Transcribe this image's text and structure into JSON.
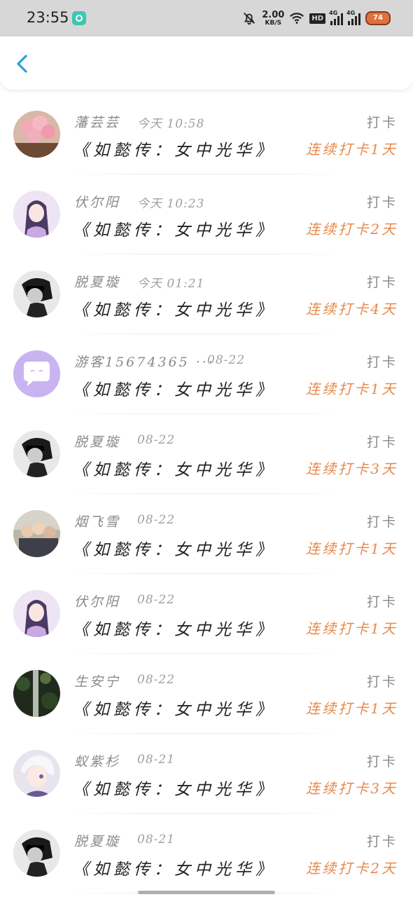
{
  "status_bar": {
    "time": "23:55",
    "speed_value": "2.00",
    "speed_unit": "KB/S",
    "hd_label": "HD",
    "net1": "4G",
    "net2": "4G",
    "battery": "74"
  },
  "header": {
    "back_icon": "chevron-left-icon"
  },
  "entries": [
    {
      "name": "藩芸芸",
      "time": "今天 10:58",
      "action": "打卡",
      "book": "《如懿传：女中光华》",
      "streak": "连续打卡1天",
      "avatar": "pink"
    },
    {
      "name": "伏尔阳",
      "time": "今天 10:23",
      "action": "打卡",
      "book": "《如懿传：女中光华》",
      "streak": "连续打卡2天",
      "avatar": "anime-purple"
    },
    {
      "name": "脱夏璇",
      "time": "今天 01:21",
      "action": "打卡",
      "book": "《如懿传：女中光华》",
      "streak": "连续打卡4天",
      "avatar": "bw"
    },
    {
      "name": "游客15674365 ···",
      "time": "08-22",
      "action": "打卡",
      "book": "《如懿传：女中光华》",
      "streak": "连续打卡1天",
      "avatar": "guest"
    },
    {
      "name": "脱夏璇",
      "time": "08-22",
      "action": "打卡",
      "book": "《如懿传：女中光华》",
      "streak": "连续打卡3天",
      "avatar": "bw"
    },
    {
      "name": "烟飞雪",
      "time": "08-22",
      "action": "打卡",
      "book": "《如懿传：女中光华》",
      "streak": "连续打卡1天",
      "avatar": "group"
    },
    {
      "name": "伏尔阳",
      "time": "08-22",
      "action": "打卡",
      "book": "《如懿传：女中光华》",
      "streak": "连续打卡1天",
      "avatar": "anime-purple"
    },
    {
      "name": "生安宁",
      "time": "08-22",
      "action": "打卡",
      "book": "《如懿传：女中光华》",
      "streak": "连续打卡1天",
      "avatar": "forest"
    },
    {
      "name": "蚁紫杉",
      "time": "08-21",
      "action": "打卡",
      "book": "《如懿传：女中光华》",
      "streak": "连续打卡3天",
      "avatar": "anime-white"
    },
    {
      "name": "脱夏璇",
      "time": "08-21",
      "action": "打卡",
      "book": "《如懿传：女中光华》",
      "streak": "连续打卡2天",
      "avatar": "bw"
    }
  ],
  "colors": {
    "accent_orange": "#e8894a",
    "back_blue": "#2a9ee0",
    "guest_avatar": "#c9b3f0"
  }
}
